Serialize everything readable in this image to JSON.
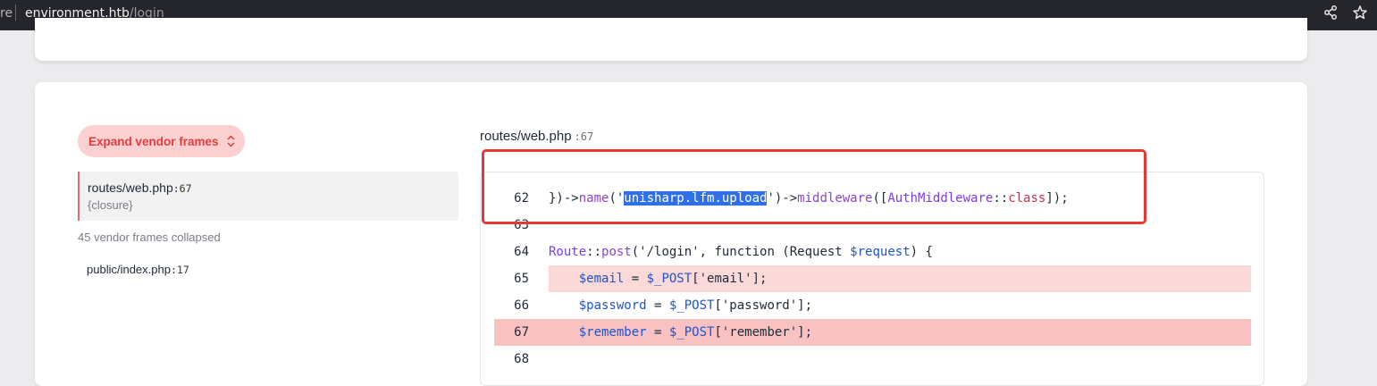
{
  "browser": {
    "prefix_fragment": "re",
    "url_host": "environment.htb",
    "url_path": "/login"
  },
  "sidebar": {
    "expand_button_label": "Expand vendor frames",
    "active_frame": {
      "file": "routes/web.php",
      "line": ":67",
      "function": "{closure}"
    },
    "collapsed_note": "45 vendor frames collapsed",
    "other_frame": {
      "file": "public/index.php",
      "line": ":17"
    }
  },
  "source": {
    "file": "routes/web.php",
    "line": ":67",
    "lines": [
      {
        "num": "62",
        "tokens": [
          {
            "t": "})->",
            "c": "plain"
          },
          {
            "t": "name",
            "c": "fn"
          },
          {
            "t": "('",
            "c": "plain"
          },
          {
            "t": "unisharp.lfm.upload",
            "c": "sel"
          },
          {
            "t": "')->",
            "c": "plain"
          },
          {
            "t": "middleware",
            "c": "fn"
          },
          {
            "t": "([",
            "c": "plain"
          },
          {
            "t": "AuthMiddleware",
            "c": "purple"
          },
          {
            "t": "::",
            "c": "plain"
          },
          {
            "t": "class",
            "c": "cls"
          },
          {
            "t": "]);",
            "c": "plain"
          }
        ]
      },
      {
        "num": "63",
        "tokens": []
      },
      {
        "num": "64",
        "tokens": [
          {
            "t": "Route",
            "c": "purple"
          },
          {
            "t": "::",
            "c": "plain"
          },
          {
            "t": "post",
            "c": "fn"
          },
          {
            "t": "('/login', function (Request ",
            "c": "plain"
          },
          {
            "t": "$request",
            "c": "var"
          },
          {
            "t": ") {",
            "c": "plain"
          }
        ]
      },
      {
        "num": "65",
        "tokens": [
          {
            "t": "    ",
            "c": "plain"
          },
          {
            "t": "$email",
            "c": "var"
          },
          {
            "t": " = ",
            "c": "plain"
          },
          {
            "t": "$_POST",
            "c": "var"
          },
          {
            "t": "['email'];",
            "c": "plain"
          }
        ]
      },
      {
        "num": "66",
        "tokens": [
          {
            "t": "    ",
            "c": "plain"
          },
          {
            "t": "$password",
            "c": "var"
          },
          {
            "t": " = ",
            "c": "plain"
          },
          {
            "t": "$_POST",
            "c": "var"
          },
          {
            "t": "['password'];",
            "c": "plain"
          }
        ]
      },
      {
        "num": "67",
        "tokens": [
          {
            "t": "    ",
            "c": "plain"
          },
          {
            "t": "$remember",
            "c": "var"
          },
          {
            "t": " = ",
            "c": "plain"
          },
          {
            "t": "$_POST",
            "c": "var"
          },
          {
            "t": "['remember'];",
            "c": "plain"
          }
        ]
      },
      {
        "num": "68",
        "tokens": []
      }
    ]
  },
  "colors": {
    "accent_red": "#e53d3d",
    "annotation_red": "#e53935",
    "selection_blue": "#2f6fe8"
  },
  "icons": [
    "share-icon",
    "star-icon",
    "chevron-up-down-icon"
  ]
}
